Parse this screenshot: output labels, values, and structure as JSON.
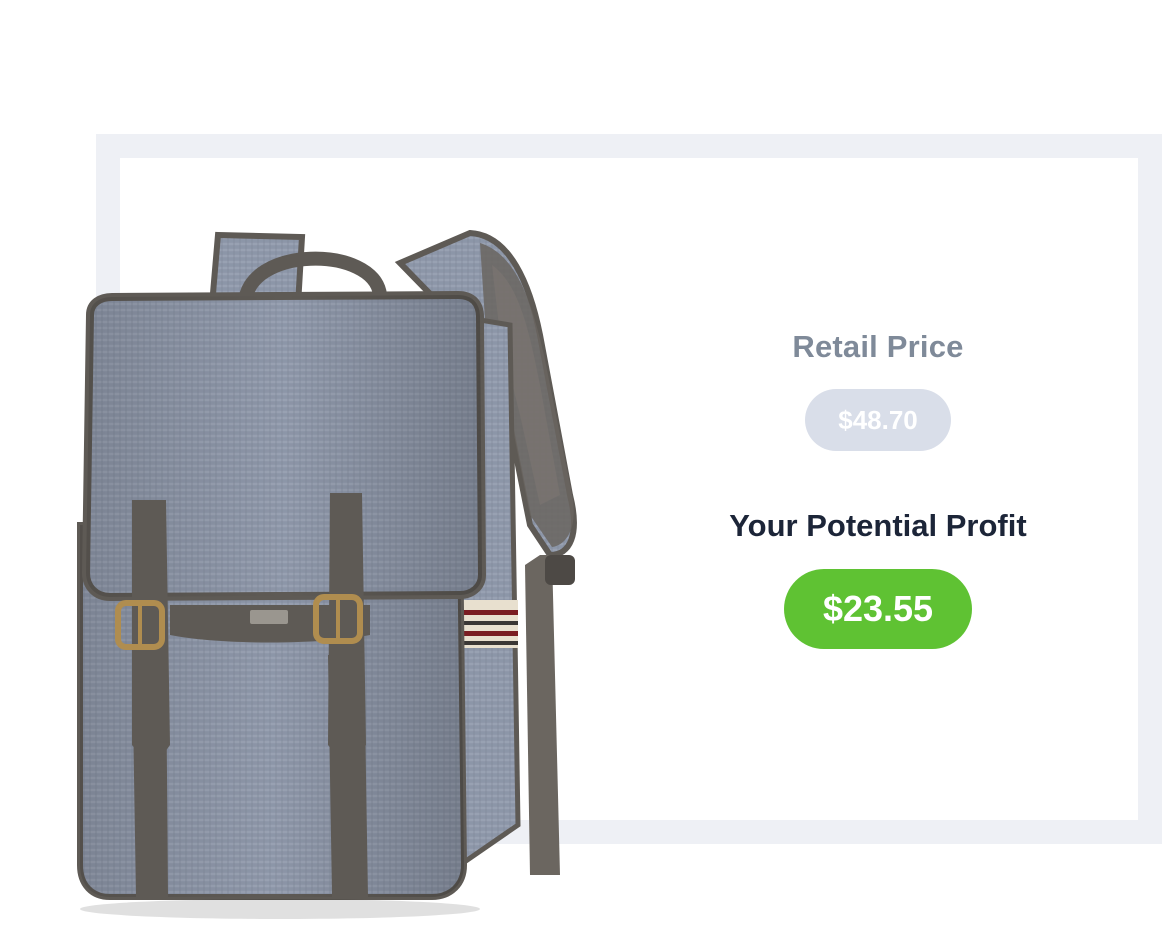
{
  "product": {
    "image_icon": "backpack-icon",
    "colors": {
      "fabric": "#8e97a8",
      "leather": "#5e5a55",
      "buckle": "#b08d4f"
    }
  },
  "pricing": {
    "retail_label": "Retail Price",
    "retail_value": "$48.70",
    "profit_label": "Your Potential Profit",
    "profit_value": "$23.55",
    "colors": {
      "retail_pill": "#d9dee9",
      "profit_pill": "#5fc233",
      "retail_label": "#7f8a99",
      "profit_label": "#1c2538"
    }
  }
}
